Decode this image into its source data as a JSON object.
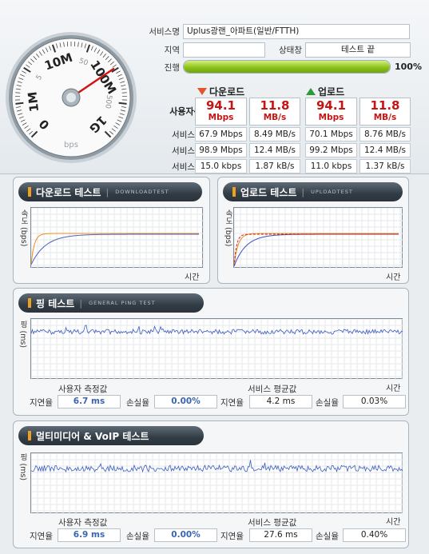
{
  "gauge": {
    "ticks": [
      "0",
      "1M",
      "5",
      "10M",
      "50",
      "100M",
      "500",
      "1G"
    ],
    "unit": "bps"
  },
  "info": {
    "service_label": "서비스명",
    "service_value": "Uplus광랜_아파트(일반/FTTH)",
    "region_label": "지역",
    "region_value": "",
    "status_label": "상태창",
    "status_value": "테스트 끝",
    "progress_label": "진행",
    "progress_pct": 100,
    "progress_text": "100%"
  },
  "stats": {
    "download_header": "다운로드",
    "upload_header": "업로드",
    "user_label": "사용자측정값",
    "download_user_mbps": "94.1",
    "download_user_mbs": "11.8",
    "upload_user_mbps": "94.1",
    "upload_user_mbs": "11.8",
    "unit_mbps": "Mbps",
    "unit_mbs": "MB/s",
    "avg_label": "서비스평균값",
    "max_label": "서비스최대값",
    "min_label": "서비스최소값",
    "avg": [
      "67.9 Mbps",
      "8.49 MB/s",
      "70.1 Mbps",
      "8.76 MB/s"
    ],
    "max": [
      "98.9 Mbps",
      "12.4 MB/s",
      "99.2 Mbps",
      "12.4 MB/s"
    ],
    "min": [
      "15.0 kbps",
      "1.87 kB/s",
      "11.0 kbps",
      "1.37 kB/s"
    ]
  },
  "colors": {
    "gauge_needle": "#d21414",
    "download_user": "#f08a1c",
    "download_avg": "#4c62c4",
    "upload_red": "#cc2020",
    "upload_blue": "#3a50c0",
    "ping_line": "#3a5cc0",
    "accent": "#c41414"
  },
  "download_test": {
    "title": "다운로드 테스트",
    "subtitle": "DOWNLOADTEST",
    "y_label": "속도 (bps)",
    "x_label": "시간"
  },
  "upload_test": {
    "title": "업로드 테스트",
    "subtitle": "UPLOADTEST",
    "y_label": "속도 (bps)",
    "x_label": "시간"
  },
  "ping_test": {
    "title": "핑 테스트",
    "subtitle": "GENERAL PING TEST",
    "y_label": "핑 (ms)",
    "x_label": "시간",
    "user_title": "사용자 측정값",
    "service_title": "서비스 평균값",
    "latency_label": "지연율",
    "loss_label": "손실율",
    "user_latency": "6.7 ms",
    "user_loss": "0.00%",
    "service_latency": "4.2 ms",
    "service_loss": "0.03%"
  },
  "voip_test": {
    "title": "멀티미디어 & VoIP 테스트",
    "y_label": "핑 (ms)",
    "x_label": "시간",
    "user_title": "사용자 측정값",
    "service_title": "서비스 평균값",
    "latency_label": "지연율",
    "loss_label": "손실율",
    "user_latency": "6.9 ms",
    "user_loss": "0.00%",
    "service_latency": "27.6 ms",
    "service_loss": "0.40%"
  }
}
